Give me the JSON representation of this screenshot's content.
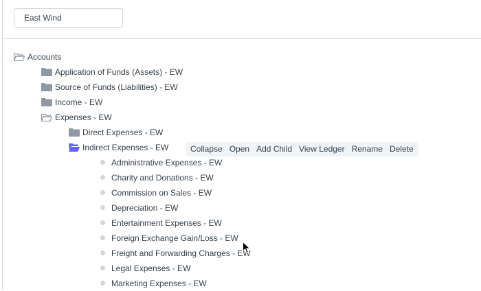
{
  "company": {
    "value": "East Wind"
  },
  "tree": {
    "root": "Accounts",
    "level1": [
      "Application of Funds (Assets) - EW",
      "Source of Funds (Liabilities) - EW",
      "Income - EW",
      "Expenses - EW"
    ],
    "level2": [
      "Direct Expenses - EW",
      "Indirect Expenses - EW"
    ],
    "leaves": [
      "Administrative Expenses - EW",
      "Charity and Donations - EW",
      "Commission on Sales - EW",
      "Depreciation - EW",
      "Entertainment Expenses - EW",
      "Foreign Exchange Gain/Loss - EW",
      "Freight and Forwarding Charges - EW",
      "Legal Expenses - EW",
      "Marketing Expenses - EW"
    ]
  },
  "toolbar": {
    "collapse": "Collapse",
    "open": "Open",
    "add_child": "Add Child",
    "view_ledger": "View Ledger",
    "rename": "Rename",
    "delete": "Delete"
  },
  "colors": {
    "folder": "#8d99a6",
    "folder_open_selected": "#5e64ff",
    "text": "#36414c",
    "toolbar_bg": "#f0f4f7",
    "border": "#d1d8dd"
  }
}
